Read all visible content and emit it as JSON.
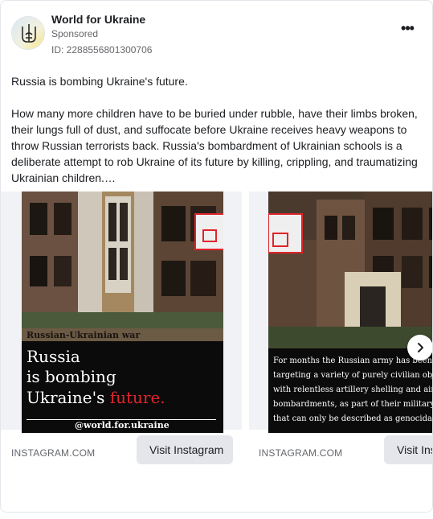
{
  "header": {
    "page_name": "World for Ukraine",
    "sponsored_label": "Sponsored",
    "ad_id": "ID: 2288556801300706",
    "more_icon": "more-horizontal-icon"
  },
  "post": {
    "paragraphs": [
      "Russia is bombing Ukraine's future.",
      "How many more children have to be buried under rubble, have their limbs broken, their lungs full of dust, and suffocate before Ukraine receives heavy weapons to throw Russian terrorists back. Russia's bombardment of Ukrainian schools is a deliberate attempt to rob Ukraine of its future by killing, crippling, and traumatizing Ukrainian children.…"
    ]
  },
  "carousel": {
    "cards": [
      {
        "poster": {
          "tag": "Russian-Ukrainian war",
          "line1": "Russia",
          "line2": "is bombing",
          "line3_prefix": "Ukraine's ",
          "line3_highlight": "future.",
          "handle": "@world.for.ukraine"
        },
        "domain": "INSTAGRAM.COM",
        "button_label": "Visit Instagram"
      },
      {
        "poster": {
          "lines": [
            "For months the Russian army has been",
            "targeting a variety of purely civilian objects",
            "with relentless artillery shelling and air",
            "bombardments, as part of their military",
            "that can only be described as genocidal"
          ]
        },
        "domain": "INSTAGRAM.COM",
        "button_label": "Visit Instagram"
      }
    ],
    "next_icon": "chevron-right-icon"
  },
  "colors": {
    "highlight_red": "#e0242a",
    "secondary_text": "#65676b",
    "button_bg": "#e4e6eb"
  }
}
